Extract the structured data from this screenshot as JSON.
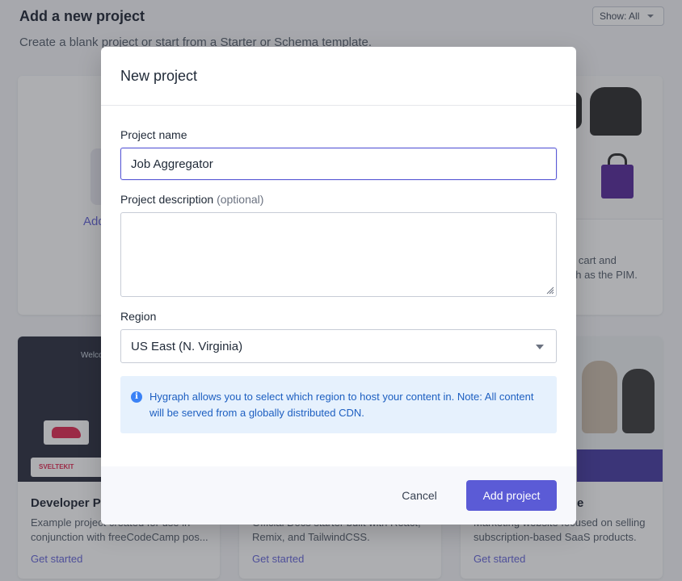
{
  "page": {
    "title": "Add a new project",
    "subtitle": "Create a blank project or start from a Starter or Schema template.",
    "filter_label": "Show: All"
  },
  "cards": {
    "blank": {
      "label": "Add"
    },
    "commerce": {
      "text_line1": "h cart and",
      "text_line2": "ph as the PIM."
    },
    "developer": {
      "image_heading": "Welco",
      "logo_text": "SVELTEKIT",
      "title": "Developer P",
      "desc_line1": "Example project created for use in",
      "desc_line2": "conjunction with freeCodeCamp pos...",
      "link": "Get started"
    },
    "remix": {
      "desc_line1": "Official Docs starter built with React,",
      "desc_line2": "Remix, and TailwindCSS.",
      "link": "Get started"
    },
    "saas": {
      "title": "e",
      "desc_line1": "Marketing website focused on selling",
      "desc_line2": "subscription-based SaaS products.",
      "link": "Get started"
    }
  },
  "modal": {
    "title": "New project",
    "name_label": "Project name",
    "name_value": "Job Aggregator",
    "description_label": "Project description",
    "description_optional": "(optional)",
    "description_value": "",
    "region_label": "Region",
    "region_value": "US East (N. Virginia)",
    "info_text": "Hygraph allows you to select which region to host your content in. Note: All content will be served from a globally distributed CDN.",
    "cancel_label": "Cancel",
    "submit_label": "Add project"
  },
  "colors": {
    "accent": "#5b5bd6",
    "info_bg": "#e6f1fd",
    "info_text": "#1d5fc1"
  },
  "icons": {
    "info": "info-circle-icon",
    "select_caret": "chevron-down-icon"
  }
}
